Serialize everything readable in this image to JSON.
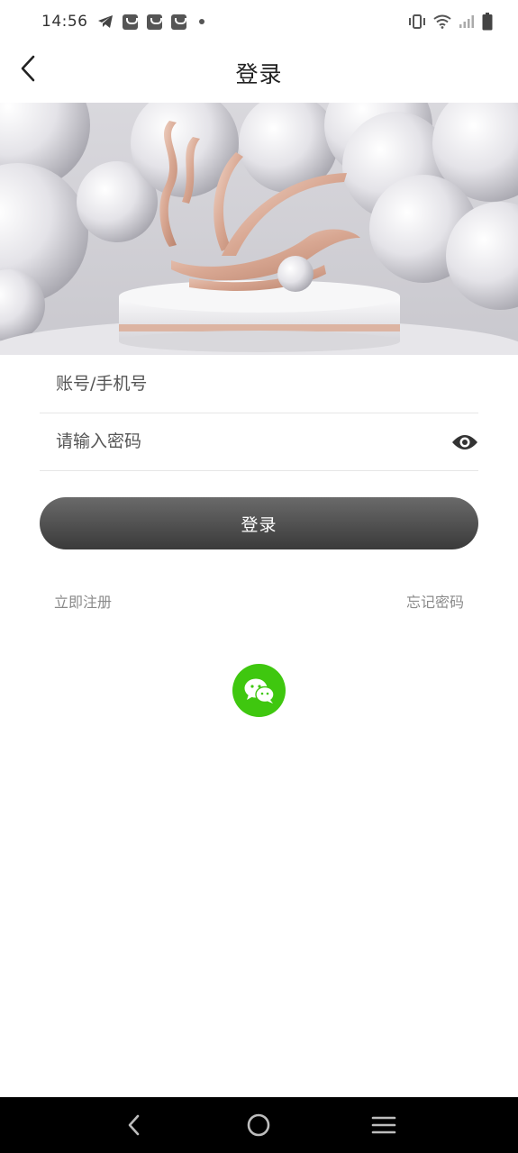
{
  "status_bar": {
    "time": "14:56",
    "icons_left": [
      "telegram-icon",
      "shopping-bag-icon",
      "shopping-bag-icon",
      "shopping-bag-icon",
      "notification-dot-icon"
    ],
    "icons_right": [
      "vibrate-icon",
      "wifi-icon",
      "signal-icon",
      "battery-icon"
    ]
  },
  "header": {
    "title": "登录",
    "back_icon": "chevron-left-icon"
  },
  "banner": {
    "description_icon": "brand-logo-banner"
  },
  "form": {
    "account_placeholder": "账号/手机号",
    "account_value": "",
    "password_placeholder": "请输入密码",
    "password_value": "",
    "password_toggle_icon": "eye-icon",
    "login_label": "登录"
  },
  "links": {
    "register": "立即注册",
    "forgot_password": "忘记密码"
  },
  "social": {
    "wechat_icon": "wechat-icon",
    "wechat_color": "#3fc70f"
  },
  "nav_bar": {
    "items": [
      "back-nav-icon",
      "home-nav-icon",
      "menu-nav-icon"
    ]
  },
  "colors": {
    "accent": "#4a4a4a",
    "wechat": "#3fc70f",
    "link": "#8a8a8a"
  }
}
